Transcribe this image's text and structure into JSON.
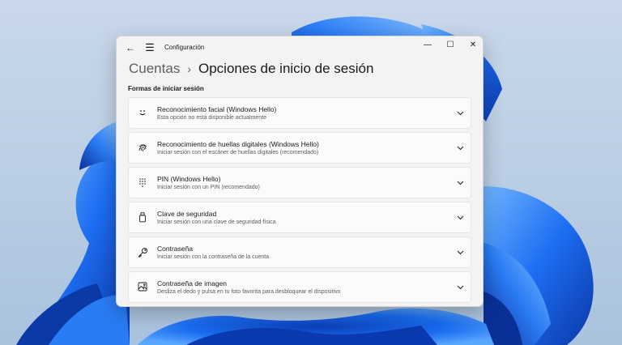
{
  "window": {
    "app_title": "Configuración",
    "back_glyph": "←",
    "menu_glyph": "☰",
    "minimize_glyph": "—",
    "maximize_glyph": "☐",
    "close_glyph": "✕"
  },
  "breadcrumb": {
    "parent": "Cuentas",
    "separator": "›",
    "current": "Opciones de inicio de sesión"
  },
  "section": {
    "title": "Formas de iniciar sesión"
  },
  "options": [
    {
      "title": "Reconocimiento facial (Windows Hello)",
      "subtitle": "Esta opción no está disponible actualmente",
      "icon": "face-icon"
    },
    {
      "title": "Reconocimiento de huellas digitales (Windows Hello)",
      "subtitle": "Iniciar sesión con el escáner de huellas digitales (recomendado)",
      "icon": "fingerprint-icon"
    },
    {
      "title": "PIN (Windows Hello)",
      "subtitle": "Iniciar sesión con un PIN (recomendado)",
      "icon": "pin-keypad-icon"
    },
    {
      "title": "Clave de seguridad",
      "subtitle": "Iniciar sesión con una clave de seguridad física",
      "icon": "usb-key-icon"
    },
    {
      "title": "Contraseña",
      "subtitle": "Iniciar sesión con la contraseña de la cuenta",
      "icon": "key-icon"
    },
    {
      "title": "Contraseña de imagen",
      "subtitle": "Desliza el dedo y pulsa en tu foto favorita para desbloquear el dispositivo",
      "icon": "image-icon"
    }
  ],
  "colors": {
    "accent": "#0a5fd8",
    "window_bg": "#f3f3f3",
    "card_bg": "#fbfbfb"
  }
}
